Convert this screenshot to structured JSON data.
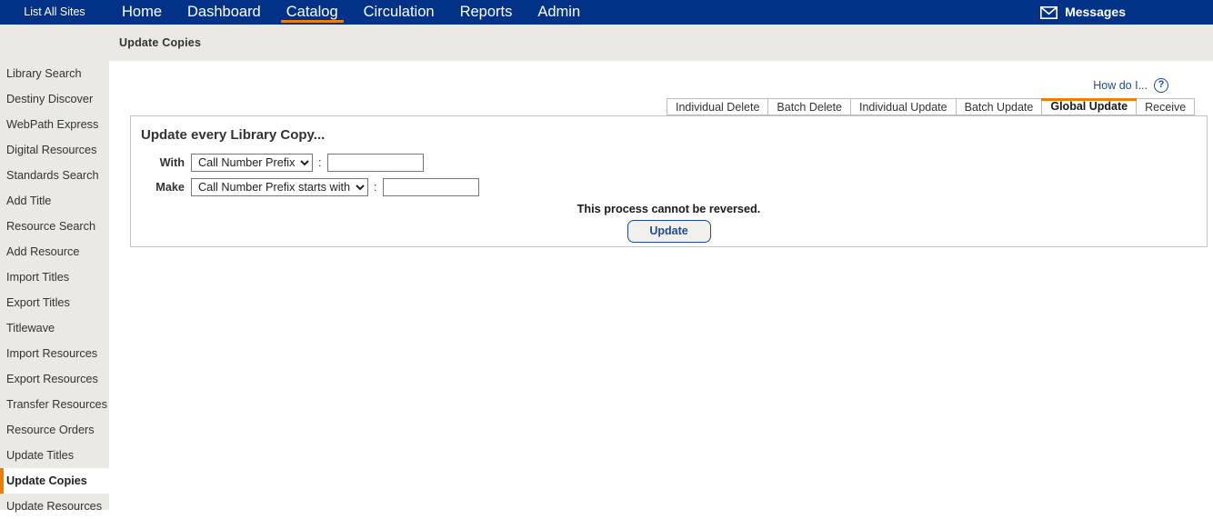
{
  "topnav": {
    "sites_button": "List All Sites",
    "menu": [
      {
        "label": "Home",
        "active": false
      },
      {
        "label": "Dashboard",
        "active": false
      },
      {
        "label": "Catalog",
        "active": true
      },
      {
        "label": "Circulation",
        "active": false
      },
      {
        "label": "Reports",
        "active": false
      },
      {
        "label": "Admin",
        "active": false
      }
    ],
    "messages_label": "Messages",
    "messages_icon": "envelope-icon",
    "background_color": "#023288",
    "accent_color": "#ef7d00"
  },
  "breadcrumb": {
    "text": "Update Copies"
  },
  "sidebar": {
    "background_color": "#eae9e3",
    "items": [
      {
        "label": "Library Search",
        "selected": false
      },
      {
        "label": "Destiny Discover",
        "selected": false
      },
      {
        "label": "WebPath Express",
        "selected": false
      },
      {
        "label": "Digital Resources",
        "selected": false
      },
      {
        "label": "Standards Search",
        "selected": false
      },
      {
        "label": "Add Title",
        "selected": false
      },
      {
        "label": "Resource Search",
        "selected": false
      },
      {
        "label": "Add Resource",
        "selected": false
      },
      {
        "label": "Import Titles",
        "selected": false
      },
      {
        "label": "Export Titles",
        "selected": false
      },
      {
        "label": "Titlewave",
        "selected": false
      },
      {
        "label": "Import Resources",
        "selected": false
      },
      {
        "label": "Export Resources",
        "selected": false
      },
      {
        "label": "Transfer Resources",
        "selected": false
      },
      {
        "label": "Resource Orders",
        "selected": false
      },
      {
        "label": "Update Titles",
        "selected": false
      },
      {
        "label": "Update Copies",
        "selected": true
      },
      {
        "label": "Update Resources",
        "selected": false
      }
    ]
  },
  "help": {
    "label": "How do I...",
    "icon": "question-mark-circle-icon",
    "color": "#1a4b9e"
  },
  "tabs": [
    {
      "label": "Individual Delete",
      "active": false
    },
    {
      "label": "Batch Delete",
      "active": false
    },
    {
      "label": "Individual Update",
      "active": false
    },
    {
      "label": "Batch Update",
      "active": false
    },
    {
      "label": "Global Update",
      "active": true
    },
    {
      "label": "Receive",
      "active": false
    }
  ],
  "panel": {
    "title": "Update every Library Copy...",
    "with_row": {
      "label": "With",
      "select_value": "Call Number Prefix",
      "select_options": [
        "Call Number Prefix"
      ],
      "separator": ":",
      "input_value": "",
      "input_placeholder": ""
    },
    "make_row": {
      "label": "Make",
      "select_value": "Call Number Prefix starts with",
      "select_options": [
        "Call Number Prefix starts with"
      ],
      "separator": ":",
      "input_value": "",
      "input_placeholder": ""
    },
    "warning": "This process cannot be reversed.",
    "update_button": "Update"
  }
}
